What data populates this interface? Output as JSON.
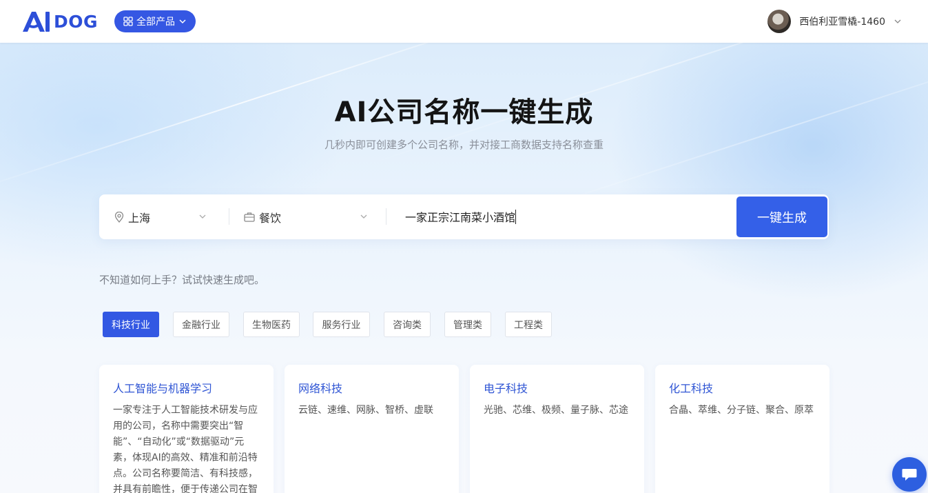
{
  "header": {
    "logo_text": "DOG",
    "products_label": "全部产品",
    "username": "西伯利亚雪橇-1460"
  },
  "hero": {
    "title": "AI公司名称一键生成",
    "subtitle": "几秒内即可创建多个公司名称，并对接工商数据支持名称查重"
  },
  "search": {
    "city": "上海",
    "industry": "餐饮",
    "name_value": "一家正宗江南菜小酒馆",
    "generate_label": "一键生成"
  },
  "hint": "不知道如何上手？试试快速生成吧。",
  "tabs": [
    {
      "label": "科技行业",
      "active": true
    },
    {
      "label": "金融行业",
      "active": false
    },
    {
      "label": "生物医药",
      "active": false
    },
    {
      "label": "服务行业",
      "active": false
    },
    {
      "label": "咨询类",
      "active": false
    },
    {
      "label": "管理类",
      "active": false
    },
    {
      "label": "工程类",
      "active": false
    }
  ],
  "cards": [
    {
      "title": "人工智能与机器学习",
      "desc": "一家专注于人工智能技术研发与应用的公司，名称中需要突出“智能”、“自动化”或“数据驱动”元素，体现AI的高效、精准和前沿特点。公司名称要简洁、有科技感，并具有前瞻性，便于传递公司在智能化"
    },
    {
      "title": "网络科技",
      "desc": "云链、速维、网脉、智桥、虚联"
    },
    {
      "title": "电子科技",
      "desc": "光驰、芯维、极频、量子脉、芯途"
    },
    {
      "title": "化工科技",
      "desc": "合晶、萃维、分子链、聚合、原萃"
    }
  ],
  "colors": {
    "accent": "#3358e3",
    "card_title": "#2f55d4"
  }
}
